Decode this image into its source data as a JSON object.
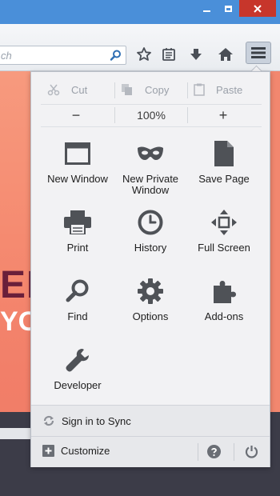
{
  "window": {
    "controls": [
      "minimize-icon",
      "maximize-icon",
      "close-icon"
    ]
  },
  "toolbar": {
    "search_text": "ch",
    "icons": [
      "search-icon",
      "star-icon",
      "reading-list-icon",
      "download-icon",
      "home-icon",
      "hamburger-menu-icon"
    ]
  },
  "page": {
    "heading_1": "EB",
    "heading_2": "YO"
  },
  "menu": {
    "edit": {
      "cut": "Cut",
      "copy": "Copy",
      "paste": "Paste"
    },
    "zoom": {
      "out": "−",
      "level": "100%",
      "in": "+"
    },
    "items": [
      {
        "label": "New Window",
        "icon": "window-icon"
      },
      {
        "label": "New Private Window",
        "icon": "mask-icon"
      },
      {
        "label": "Save Page",
        "icon": "page-icon"
      },
      {
        "label": "Print",
        "icon": "printer-icon"
      },
      {
        "label": "History",
        "icon": "clock-icon"
      },
      {
        "label": "Full Screen",
        "icon": "fullscreen-icon"
      },
      {
        "label": "Find",
        "icon": "magnifier-icon"
      },
      {
        "label": "Options",
        "icon": "gear-icon"
      },
      {
        "label": "Add-ons",
        "icon": "puzzle-icon"
      },
      {
        "label": "Developer",
        "icon": "wrench-icon"
      }
    ],
    "sync_label": "Sign in to Sync",
    "customize_label": "Customize"
  },
  "colors": {
    "titlebar": "#4a8fd9",
    "close": "#c7362b",
    "panel": "#f2f2f4",
    "page_accent": "#f58a70"
  }
}
